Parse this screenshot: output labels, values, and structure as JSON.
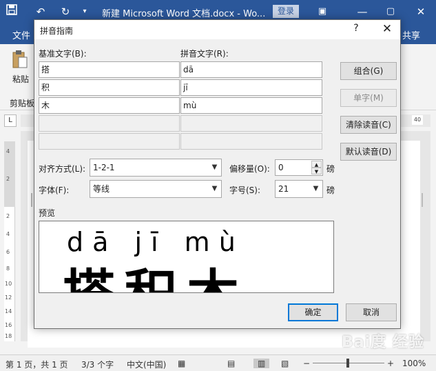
{
  "word": {
    "title": "新建 Microsoft Word 文档.docx  -  Wo...",
    "login_label": "登录",
    "tab_file": "文件",
    "tab_share": "共享",
    "paste_label": "粘贴",
    "clipboard_label": "剪贴板",
    "ruler_corner": "L",
    "ruler_right_number": "40",
    "vruler_numbers": [
      "4",
      "2",
      "2",
      "4",
      "6",
      "8",
      "10",
      "12",
      "14",
      "16",
      "18"
    ]
  },
  "dialog": {
    "title": "拼音指南",
    "help": "?",
    "base_text_label": "基准文字(B):",
    "ruby_text_label": "拼音文字(R):",
    "rows": [
      {
        "base": "搭",
        "ruby": "dā"
      },
      {
        "base": "积",
        "ruby": "jī"
      },
      {
        "base": "木",
        "ruby": "mù"
      },
      {
        "base": "",
        "ruby": ""
      },
      {
        "base": "",
        "ruby": ""
      }
    ],
    "buttons": {
      "group": "组合(G)",
      "mono": "单字(M)",
      "clear": "清除读音(C)",
      "default": "默认读音(D)",
      "ok": "确定",
      "cancel": "取消"
    },
    "alignment_label": "对齐方式(L):",
    "alignment_value": "1-2-1",
    "offset_label": "偏移量(O):",
    "offset_value": "0",
    "offset_unit": "磅",
    "font_label": "字体(F):",
    "font_value": "等线",
    "size_label": "字号(S):",
    "size_value": "21",
    "size_unit": "磅",
    "preview_label": "预览",
    "preview_pinyin": "dā  jī  mù",
    "preview_chars": "搭积木"
  },
  "status": {
    "page": "第 1 页，共 1 页",
    "words": "3/3 个字",
    "language": "中文(中国)",
    "zoom": "100%",
    "zoom_minus": "−",
    "zoom_plus": "+"
  },
  "watermark": "Bai度 经验"
}
